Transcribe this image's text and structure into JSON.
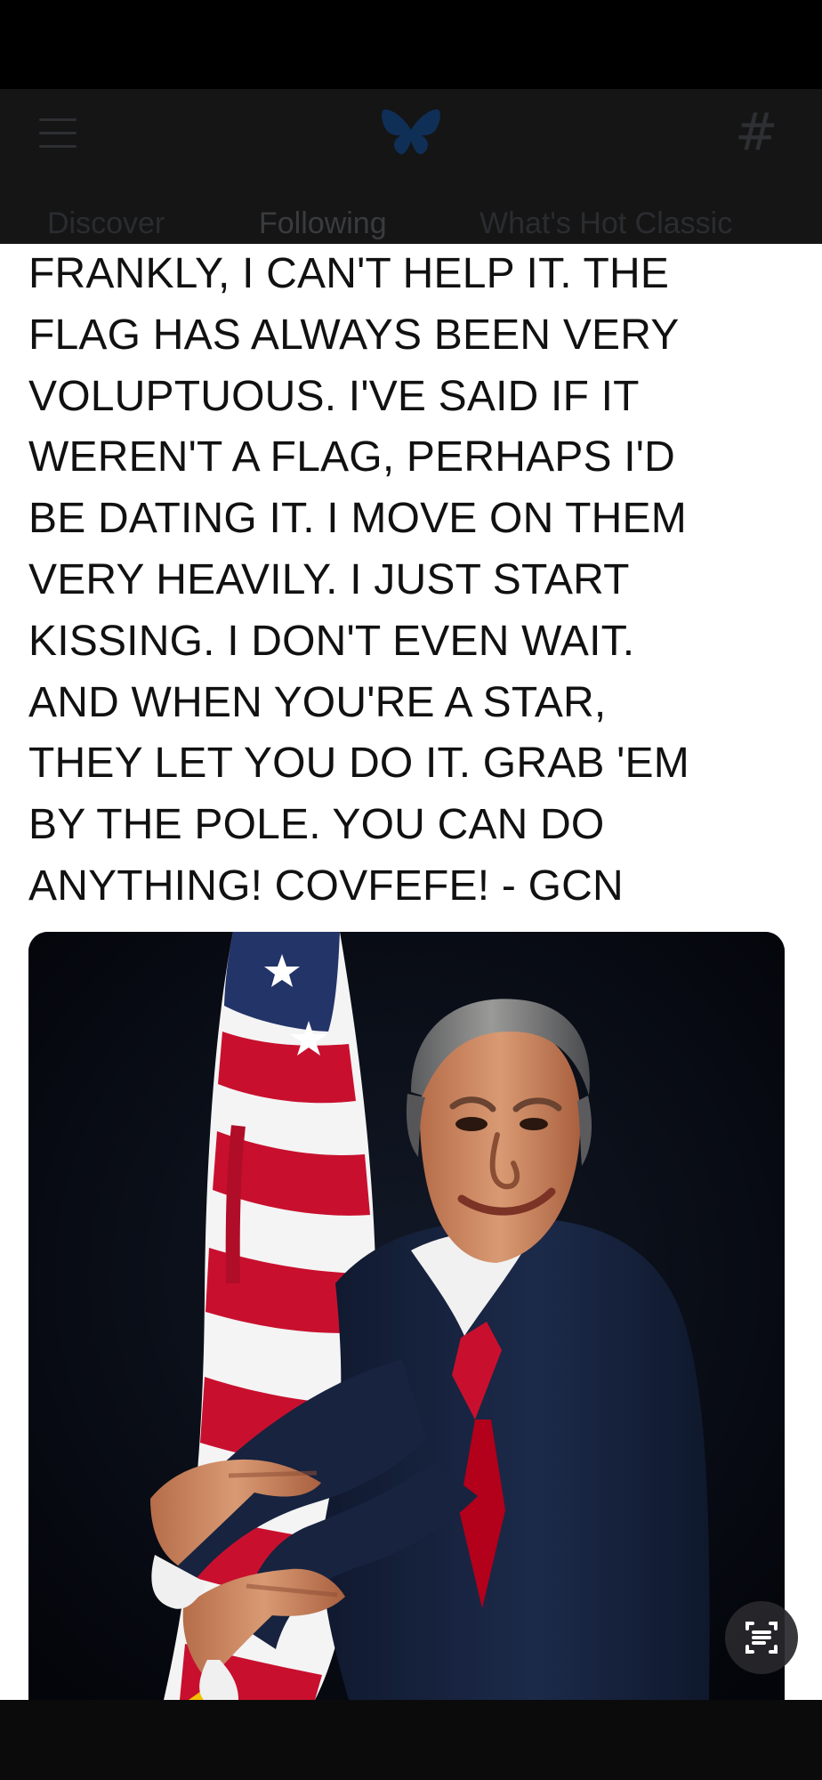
{
  "header": {
    "tabs": [
      {
        "label": "Discover"
      },
      {
        "label": "Following"
      },
      {
        "label": "What's Hot Classic"
      }
    ],
    "icons": [
      "menu-icon",
      "butterfly-logo-icon",
      "hashtag-icon"
    ]
  },
  "post": {
    "lines": [
      "FRANKLY, I CAN'T HELP IT. THE",
      "FLAG HAS ALWAYS BEEN VERY",
      "VOLUPTUOUS. I'VE SAID IF IT",
      "WEREN'T A FLAG, PERHAPS I'D",
      "BE DATING IT. I MOVE ON THEM",
      "VERY HEAVILY. I JUST START",
      "KISSING. I DON'T EVEN WAIT.",
      "AND WHEN YOU'RE A STAR,",
      "THEY LET YOU DO IT. GRAB 'EM",
      "BY THE POLE. YOU CAN DO",
      "ANYTHING! COVFEFE! - GCN"
    ]
  },
  "colors": {
    "header_bg": "#151515",
    "post_bg": "#ffffff",
    "text": "#111111",
    "flag_red": "#c8102e",
    "flag_blue": "#24346b",
    "suit_navy": "#17233f"
  }
}
